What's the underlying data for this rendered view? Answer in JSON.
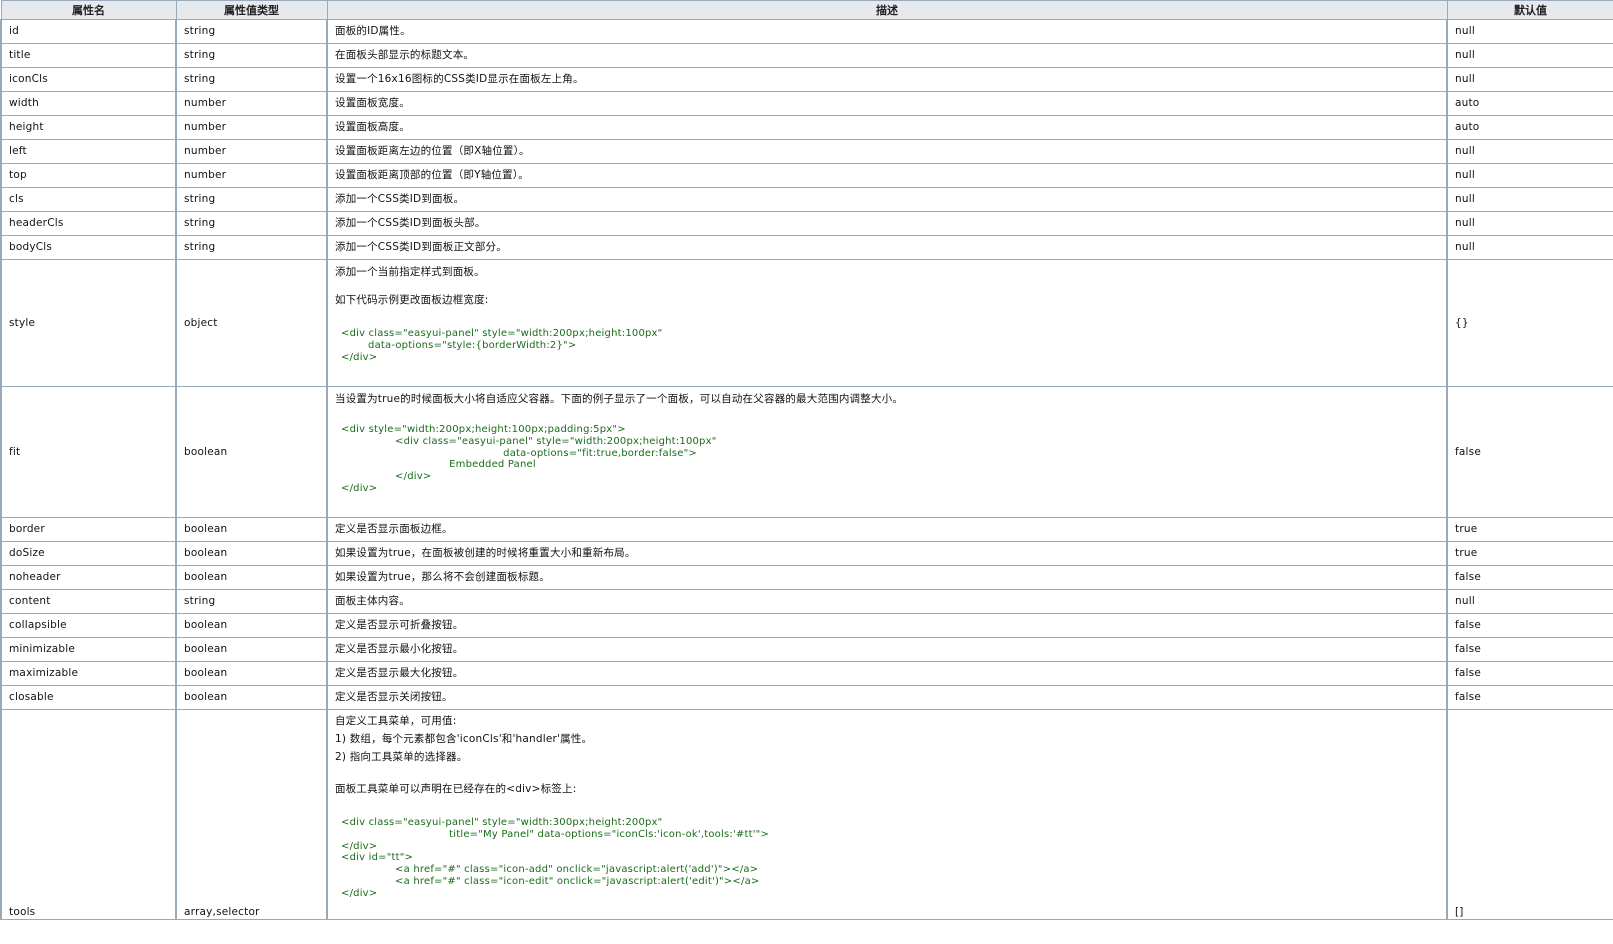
{
  "headers": {
    "name": "属性名",
    "type": "属性值类型",
    "desc": "描述",
    "default": "默认值"
  },
  "rows": [
    {
      "name": "id",
      "type": "string",
      "desc": "面板的ID属性。",
      "default": "null"
    },
    {
      "name": "title",
      "type": "string",
      "desc": "在面板头部显示的标题文本。",
      "default": "null"
    },
    {
      "name": "iconCls",
      "type": "string",
      "desc": "设置一个16x16图标的CSS类ID显示在面板左上角。",
      "default": "null"
    },
    {
      "name": "width",
      "type": "number",
      "desc": "设置面板宽度。",
      "default": "auto"
    },
    {
      "name": "height",
      "type": "number",
      "desc": "设置面板高度。",
      "default": "auto"
    },
    {
      "name": "left",
      "type": "number",
      "desc": "设置面板距离左边的位置（即X轴位置）。",
      "default": "null"
    },
    {
      "name": "top",
      "type": "number",
      "desc": "设置面板距离顶部的位置（即Y轴位置）。",
      "default": "null"
    },
    {
      "name": "cls",
      "type": "string",
      "desc": "添加一个CSS类ID到面板。",
      "default": "null"
    },
    {
      "name": "headerCls",
      "type": "string",
      "desc": "添加一个CSS类ID到面板头部。",
      "default": "null"
    },
    {
      "name": "bodyCls",
      "type": "string",
      "desc": "添加一个CSS类ID到面板正文部分。",
      "default": "null"
    },
    {
      "name": "style",
      "type": "object",
      "default": "{}",
      "desc_lines": [
        "添加一个当前指定样式到面板。",
        "如下代码示例更改面板边框宽度:"
      ],
      "code": "<div class=\"easyui-panel\" style=\"width:200px;height:100px\"\n        data-options=\"style:{borderWidth:2}\">\n</div>"
    },
    {
      "name": "fit",
      "type": "boolean",
      "default": "false",
      "desc_lines": [
        "当设置为true的时候面板大小将自适应父容器。下面的例子显示了一个面板，可以自动在父容器的最大范围内调整大小。"
      ],
      "code": "<div style=\"width:200px;height:100px;padding:5px\">\n                <div class=\"easyui-panel\" style=\"width:200px;height:100px\"\n                                                data-options=\"fit:true,border:false\">\n                                Embedded Panel\n                </div>\n</div>"
    },
    {
      "name": "border",
      "type": "boolean",
      "desc": "定义是否显示面板边框。",
      "default": "true"
    },
    {
      "name": "doSize",
      "type": "boolean",
      "desc": "如果设置为true，在面板被创建的时候将重置大小和重新布局。",
      "default": "true"
    },
    {
      "name": "noheader",
      "type": "boolean",
      "desc": "如果设置为true，那么将不会创建面板标题。",
      "default": "false"
    },
    {
      "name": "content",
      "type": "string",
      "desc": "面板主体内容。",
      "default": "null"
    },
    {
      "name": "collapsible",
      "type": "boolean",
      "desc": "定义是否显示可折叠按钮。",
      "default": "false"
    },
    {
      "name": "minimizable",
      "type": "boolean",
      "desc": "定义是否显示最小化按钮。",
      "default": "false"
    },
    {
      "name": "maximizable",
      "type": "boolean",
      "desc": "定义是否显示最大化按钮。",
      "default": "false"
    },
    {
      "name": "closable",
      "type": "boolean",
      "desc": "定义是否显示关闭按钮。",
      "default": "false"
    },
    {
      "name": "tools",
      "type": "array,selector",
      "default": "[]",
      "desc_lines": [
        "自定义工具菜单，可用值:",
        "1) 数组，每个元素都包含'iconCls'和'handler'属性。",
        "2) 指向工具菜单的选择器。",
        "面板工具菜单可以声明在已经存在的<div>标签上:"
      ],
      "code": "<div class=\"easyui-panel\" style=\"width:300px;height:200px\"\n                                title=\"My Panel\" data-options=\"iconCls:'icon-ok',tools:'#tt'\">\n</div>\n<div id=\"tt\">\n                <a href=\"#\" class=\"icon-add\" onclick=\"javascript:alert('add')\"></a>\n                <a href=\"#\" class=\"icon-edit\" onclick=\"javascript:alert('edit')\"></a>\n</div>"
    }
  ]
}
